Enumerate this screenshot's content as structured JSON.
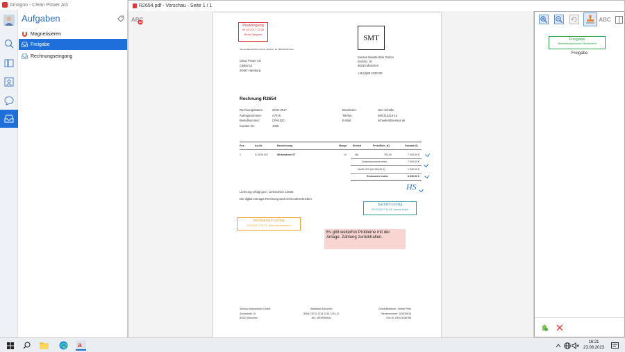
{
  "app": {
    "title": "Amagno - Clean Power AG",
    "task_panel_title": "Aufgaben",
    "tasks": [
      {
        "label": "Magnetisieren",
        "icon": "magnet-icon"
      },
      {
        "label": "Freigabe",
        "icon": "inbox-icon"
      },
      {
        "label": "Rechnungseingang",
        "icon": "inbox-icon"
      }
    ]
  },
  "viewer": {
    "title": "R2654.pdf - Vorschau - Seite 1 / 1",
    "stamp_tool_label": "ABC"
  },
  "document": {
    "posteingang": {
      "title": "Posteingang",
      "date": "09.03.2017 12:08",
      "name": "Bernd Wagner"
    },
    "sender_line": "Sensus Messtechnik GmbH  |  Zechstr. 10  |  80333 München",
    "recipient": [
      "Clean Power AG",
      "Citykai 12",
      "20457 Hamburg"
    ],
    "logo_text": "SMT",
    "company": [
      "Sensus Messtechnik GmbH",
      "Zechstr. 10",
      "80333 München",
      "",
      "+49 (0)89 2132130"
    ],
    "invoice_title": "Rechnung R2654",
    "meta_left": [
      {
        "k": "Rechnungsdatum:",
        "v": "20.01.2017"
      },
      {
        "k": "Auftragsnummer:",
        "v": "A7575"
      },
      {
        "k": "Bestellnummer:",
        "v": "CPA1820"
      },
      {
        "k": "Kunden-Nr.:",
        "v": "1068"
      }
    ],
    "meta_right": [
      {
        "k": "Bearbeiter:",
        "v": "Herr Schäfer"
      },
      {
        "k": "Telefon:",
        "v": "089 213213-13"
      },
      {
        "k": "E-Mail:",
        "v": "schaefer@sensus.de"
      }
    ],
    "table_headers": [
      "Pos.",
      "Art-Nr.",
      "Bezeichnung",
      "Menge",
      "Einheit",
      "Preis/Einh. (€)",
      "Gesamt (€)"
    ],
    "row": [
      "1",
      "D-0109-022",
      "Wirbelstrom XT",
      "10",
      "Stk.",
      "700,00",
      "7.000,00 €"
    ],
    "totals": [
      {
        "k": "Zwischensumme netto",
        "v": "7.000,00 €"
      },
      {
        "k": "MwSt 19% (50.965,00 €)",
        "v": "1.330,00 €"
      },
      {
        "k": "Endsumme brutto",
        "v": "8.330,00 €"
      }
    ],
    "lieferung": "Lieferung erfolgt gem. Lieferschein L2034.",
    "digital_note": "Die digital erzeugte Rechnung wird nicht unterschrieben.",
    "initials": "HS",
    "sachlich": {
      "title": "Sachlich richtig",
      "date": "09.03.2017 11:24",
      "name": "Janine Hank"
    },
    "rechnerisch": {
      "title": "Rechnerisch richtig",
      "date": "09.03.2017 11:23",
      "name": "Mark Zimmermann"
    },
    "note": "Es gibt weiterhin Probleme mit der Anlage. Zahlung zurückhalten.",
    "footer_left": [
      "Sensus Messtechnik GmbH",
      "Zechstraße 10",
      "80333 München"
    ],
    "footer_mid": [
      "Stadtbank München",
      "IBAN: DE15 1234 1234 1234 12",
      "BIC: BRSPAMUN"
    ],
    "footer_right": [
      "Geschäftsführer: Stefan Preis",
      "Steuernummer: 181930815",
      "USt-ID: DE223456789"
    ]
  },
  "right_panel": {
    "stamp_title": "Freigabe",
    "stamp_tags": "#Bearbeitungsstatus#  #Bearbeiter#",
    "stamp_caption": "Freigabe",
    "abc_label": "ABC"
  },
  "taskbar": {
    "time": "16:21",
    "date": "23.08.2023"
  },
  "colors": {
    "accent": "#1e6fd9",
    "red_stamp": "#d9303a",
    "green_stamp": "#2ea24a",
    "teal_stamp": "#2a9aa5",
    "orange_stamp": "#f0a020",
    "note_bg": "#f8d5d0"
  }
}
